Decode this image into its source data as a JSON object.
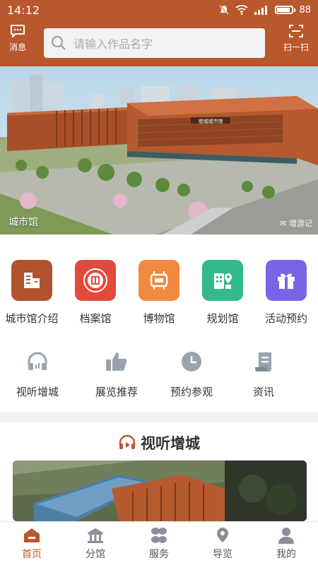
{
  "status_bar": {
    "time": "14:12",
    "battery": "88",
    "battery_level": 0.88
  },
  "header": {
    "message_label": "消息",
    "search_placeholder": "请输入作品名字",
    "scan_label": "扫一扫"
  },
  "banner": {
    "caption": "城市馆",
    "watermark": "增游记",
    "building_sign": "增城城市馆"
  },
  "shortcuts": [
    {
      "label": "城市馆介绍",
      "icon": "city-hall-icon",
      "color": "#b0532d"
    },
    {
      "label": "档案馆",
      "icon": "archive-seal-icon",
      "color": "#e14b3b"
    },
    {
      "label": "博物馆",
      "icon": "museum-icon",
      "color": "#f18a3e"
    },
    {
      "label": "规划馆",
      "icon": "planning-map-icon",
      "color": "#34b98e"
    },
    {
      "label": "活动预约",
      "icon": "gift-icon",
      "color": "#7b63e6"
    }
  ],
  "services": [
    {
      "label": "视听增城",
      "icon": "headphones-icon"
    },
    {
      "label": "展览推荐",
      "icon": "thumbs-up-icon"
    },
    {
      "label": "预约参观",
      "icon": "clock-icon"
    },
    {
      "label": "资讯",
      "icon": "news-scroll-icon"
    }
  ],
  "section": {
    "title": "视听增城"
  },
  "tabs": [
    {
      "label": "首页",
      "icon": "home-icon",
      "active": true
    },
    {
      "label": "分馆",
      "icon": "pavilion-icon",
      "active": false
    },
    {
      "label": "服务",
      "icon": "services-icon",
      "active": false
    },
    {
      "label": "导览",
      "icon": "location-pin-icon",
      "active": false
    },
    {
      "label": "我的",
      "icon": "user-icon",
      "active": false
    }
  ],
  "colors": {
    "brand": "#b9572d",
    "gray_icon": "#9aa3ad"
  }
}
